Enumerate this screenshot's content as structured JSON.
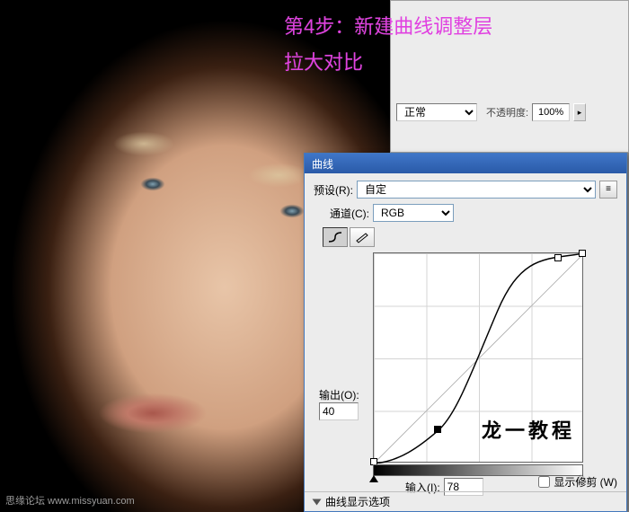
{
  "step_text_line1": "第4步：新建曲线调整层",
  "step_text_line2": "拉大对比",
  "watermark": "思缘论坛   www.missyuan.com",
  "layers": {
    "blend_mode": "正常",
    "opacity_label": "不透明度:",
    "opacity_value": "100%"
  },
  "curves": {
    "title": "曲线",
    "preset_label": "预设(R):",
    "preset_value": "自定",
    "channel_label": "通道(C):",
    "channel_value": "RGB",
    "output_label": "输出(O):",
    "output_value": "40",
    "input_label": "输入(I):",
    "input_value": "78",
    "show_clip_label": "显示修剪 (W)",
    "expand_label": "曲线显示选项",
    "chart_watermark": "龙一教程"
  },
  "chart_data": {
    "type": "line",
    "title": "Curves",
    "xlabel": "Input",
    "ylabel": "Output",
    "xlim": [
      0,
      255
    ],
    "ylim": [
      0,
      255
    ],
    "grid": true,
    "series": [
      {
        "name": "baseline",
        "x": [
          0,
          255
        ],
        "y": [
          0,
          255
        ]
      },
      {
        "name": "curve",
        "x": [
          0,
          30,
          78,
          128,
          185,
          225,
          255
        ],
        "y": [
          0,
          4,
          40,
          140,
          225,
          250,
          255
        ]
      }
    ],
    "control_points": [
      {
        "x": 0,
        "y": 0,
        "selected": false
      },
      {
        "x": 78,
        "y": 40,
        "selected": true
      },
      {
        "x": 225,
        "y": 250,
        "selected": false
      },
      {
        "x": 255,
        "y": 255,
        "selected": false
      }
    ]
  }
}
